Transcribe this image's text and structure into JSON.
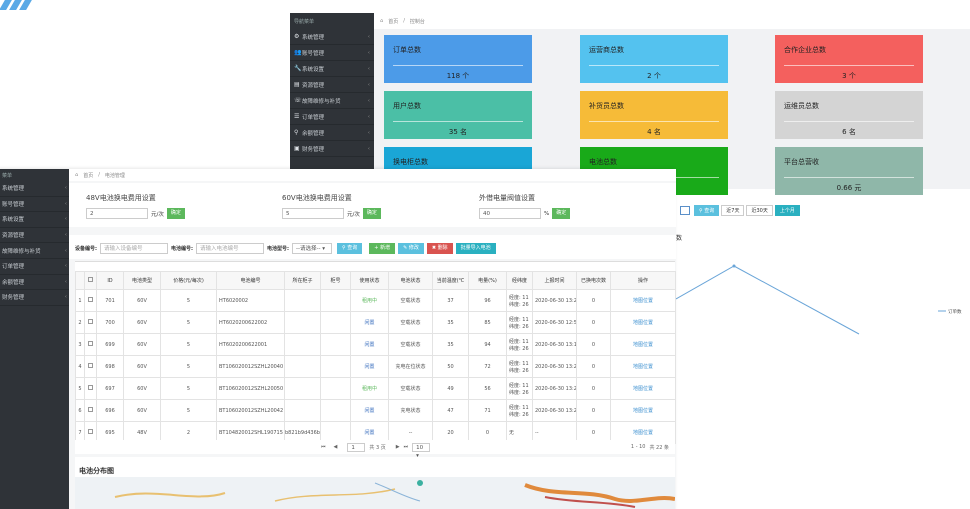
{
  "back": {
    "sidebar_title": "导航菜单",
    "menu": [
      {
        "icon": "cog-icon",
        "label": "系统管理"
      },
      {
        "icon": "users-icon",
        "label": "账号管理"
      },
      {
        "icon": "wrench-icon",
        "label": "系统设置"
      },
      {
        "icon": "folder-icon",
        "label": "资源管理"
      },
      {
        "icon": "phone-icon",
        "label": "故障维修与补货"
      },
      {
        "icon": "list-icon",
        "label": "订单管理"
      },
      {
        "icon": "search-icon",
        "label": "余额管理"
      },
      {
        "icon": "briefcase-icon",
        "label": "财务管理"
      }
    ],
    "breadcrumb": {
      "home": "首页",
      "page": "控制台"
    },
    "cards": [
      {
        "title": "订单总数",
        "value": "118 个",
        "color": "#4c9be8"
      },
      {
        "title": "运营商总数",
        "value": "2 个",
        "color": "#54c2ef"
      },
      {
        "title": "合作企业总数",
        "value": "3 个",
        "color": "#f4605e"
      },
      {
        "title": "用户总数",
        "value": "35 名",
        "color": "#4bbfa6"
      },
      {
        "title": "补货员总数",
        "value": "4 名",
        "color": "#f6bb38"
      },
      {
        "title": "运维员总数",
        "value": "6 名",
        "color": "#d4d4d4"
      },
      {
        "title": "换电柜总数",
        "value": "",
        "color": "#1aa6d6"
      },
      {
        "title": "电池总数",
        "value": "",
        "color": "#19aa19"
      },
      {
        "title": "平台总营收",
        "value": "0.66 元",
        "color": "#8fb7a9"
      }
    ],
    "trend": {
      "query_label": "查询",
      "ranges": [
        "近7天",
        "近30天",
        "上个月"
      ],
      "title": "数",
      "legend": "订单数"
    }
  },
  "front": {
    "sidebar_title": "菜单",
    "menu": [
      "系统管理",
      "账号管理",
      "系统设置",
      "资源管理",
      "故障维修与补货",
      "订单管理",
      "余额管理",
      "财务管理"
    ],
    "breadcrumb": {
      "home": "首页",
      "page": "电池管理"
    },
    "settings": [
      {
        "title": "48V电池换电费用设置",
        "value": "2",
        "unit": "元/次",
        "btn": "确定"
      },
      {
        "title": "60V电池换电费用设置",
        "value": "5",
        "unit": "元/次",
        "btn": "确定"
      },
      {
        "title": "外借电量阀值设置",
        "value": "40",
        "unit": "%",
        "btn": "确定"
      }
    ],
    "filter": {
      "device_label": "设备编号:",
      "device_placeholder": "请输入设备编号",
      "battery_label": "电池编号:",
      "battery_placeholder": "请输入电池编号",
      "type_label": "电池型号:",
      "type_value": "--请选择--",
      "search": "查询",
      "add": "新增",
      "edit": "修改",
      "delete": "删除",
      "import": "批量导入电池"
    },
    "columns": [
      "",
      "ID",
      "电池类型",
      "价格(元/每次)",
      "电池编号",
      "所在柜子",
      "柜号",
      "使用状态",
      "电池状态",
      "当前温度(℃",
      "电量(%)",
      "经纬度",
      "上报时间",
      "已换电次数",
      "操作"
    ],
    "rows": [
      {
        "n": "1",
        "id": "701",
        "type": "60V",
        "price": "5",
        "code": "HT6020002",
        "cab": "",
        "no": "",
        "use": "租用中",
        "use_c": "green",
        "state": "空载状态",
        "temp": "37",
        "pct": "96",
        "geo": "经度: 11 纬度: 26",
        "time": "2020-06-30 13:23:1",
        "cnt": "0",
        "op": "地图位置"
      },
      {
        "n": "2",
        "id": "700",
        "type": "60V",
        "price": "5",
        "code": "HT6020200622002",
        "cab": "",
        "no": "",
        "use": "闲置",
        "use_c": "blue",
        "state": "空载状态",
        "temp": "35",
        "pct": "85",
        "geo": "经度: 11 纬度: 26",
        "time": "2020-06-30 12:57:2",
        "cnt": "0",
        "op": "地图位置"
      },
      {
        "n": "3",
        "id": "699",
        "type": "60V",
        "price": "5",
        "code": "HT6020200622001",
        "cab": "",
        "no": "",
        "use": "闲置",
        "use_c": "blue",
        "state": "空载状态",
        "temp": "35",
        "pct": "94",
        "geo": "经度: 11 纬度: 26",
        "time": "2020-06-30 13:13:2",
        "cnt": "0",
        "op": "地图位置"
      },
      {
        "n": "4",
        "id": "698",
        "type": "60V",
        "price": "5",
        "code": "BT106020012SZHL20040",
        "cab": "",
        "no": "",
        "use": "闲置",
        "use_c": "blue",
        "state": "充电在位状态",
        "temp": "50",
        "pct": "72",
        "geo": "经度: 11 纬度: 26",
        "time": "2020-06-30 13:22:3",
        "cnt": "0",
        "op": "地图位置"
      },
      {
        "n": "5",
        "id": "697",
        "type": "60V",
        "price": "5",
        "code": "BT106020012SZHL20050",
        "cab": "",
        "no": "",
        "use": "租用中",
        "use_c": "green",
        "state": "空载状态",
        "temp": "49",
        "pct": "56",
        "geo": "经度: 11 纬度: 26",
        "time": "2020-06-30 13:22:3",
        "cnt": "0",
        "op": "地图位置"
      },
      {
        "n": "6",
        "id": "696",
        "type": "60V",
        "price": "5",
        "code": "BT106020012SZHL20042",
        "cab": "",
        "no": "",
        "use": "闲置",
        "use_c": "blue",
        "state": "充电状态",
        "temp": "47",
        "pct": "71",
        "geo": "经度: 11 纬度: 26",
        "time": "2020-06-30 13:22:3",
        "cnt": "0",
        "op": "地图位置"
      },
      {
        "n": "7",
        "id": "695",
        "type": "48V",
        "price": "2",
        "code": "BT104820012SHL190715",
        "cab": "b821b9d436b84",
        "no": "",
        "use": "闲置",
        "use_c": "blue",
        "state": "--",
        "temp": "20",
        "pct": "0",
        "geo": "无",
        "time": "--",
        "cnt": "0",
        "op": "地图位置"
      }
    ],
    "pager": {
      "page": "1",
      "of": "共 3 页",
      "size": "10",
      "range": "1 - 10",
      "total": "共 22 条"
    },
    "map_title": "电池分布图"
  },
  "colors": {
    "green": "#5cb85c",
    "blue": "#5bc0de",
    "orange": "#f0ad4e",
    "red": "#d9534f",
    "teal": "#2ab0c0",
    "sidebar": "#2f3338"
  }
}
